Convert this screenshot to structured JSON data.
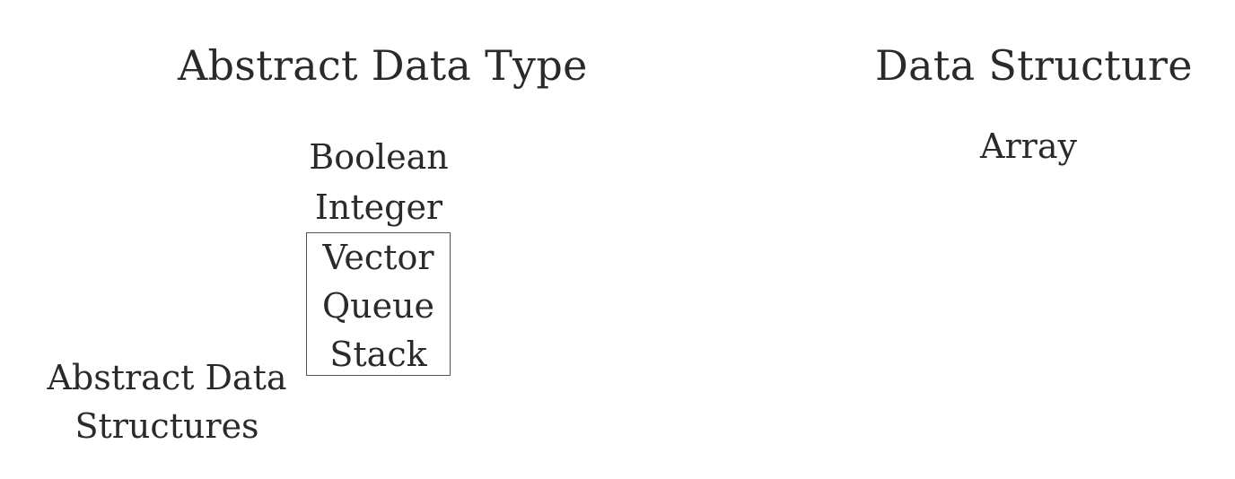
{
  "left_column": {
    "heading": "Abstract Data Type",
    "items": [
      "Boolean",
      "Integer"
    ],
    "boxed_items": [
      "Vector",
      "Queue",
      "Stack"
    ],
    "box_label_line1": "Abstract Data",
    "box_label_line2": "Structures"
  },
  "right_column": {
    "heading": "Data Structure",
    "items": [
      "Array"
    ]
  }
}
